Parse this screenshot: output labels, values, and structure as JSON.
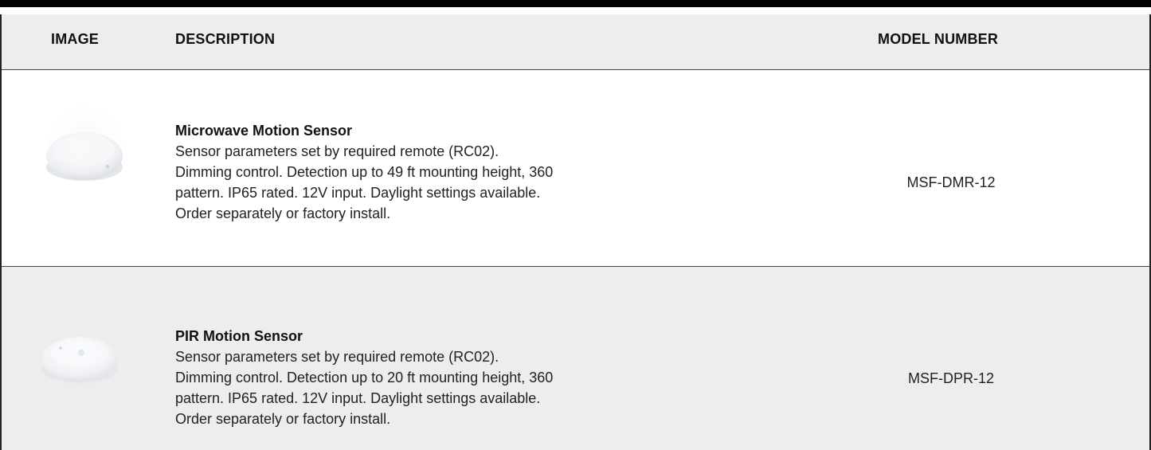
{
  "header": {
    "image": "IMAGE",
    "description": "DESCRIPTION",
    "model_number": "MODEL NUMBER"
  },
  "rows": [
    {
      "title": "Microwave Motion Sensor",
      "lines": [
        "Sensor parameters set by required remote (RC02).",
        "Dimming control. Detection up to 49 ft mounting height, 360",
        "pattern. IP65 rated. 12V input. Daylight settings available.",
        "Order separately or factory install."
      ],
      "model": "MSF-DMR-12",
      "image_icon": "microwave-sensor-image"
    },
    {
      "title": "PIR Motion Sensor",
      "lines": [
        "Sensor parameters set by required remote (RC02).",
        "Dimming control. Detection up to 20 ft mounting height, 360",
        "pattern. IP65 rated. 12V input. Daylight settings available.",
        "Order separately or factory install."
      ],
      "model": "MSF-DPR-12",
      "image_icon": "pir-sensor-image"
    }
  ],
  "colors": {
    "header_bg": "#ededed",
    "alt_row_bg": "#ededed",
    "top_bar": "#000000"
  }
}
